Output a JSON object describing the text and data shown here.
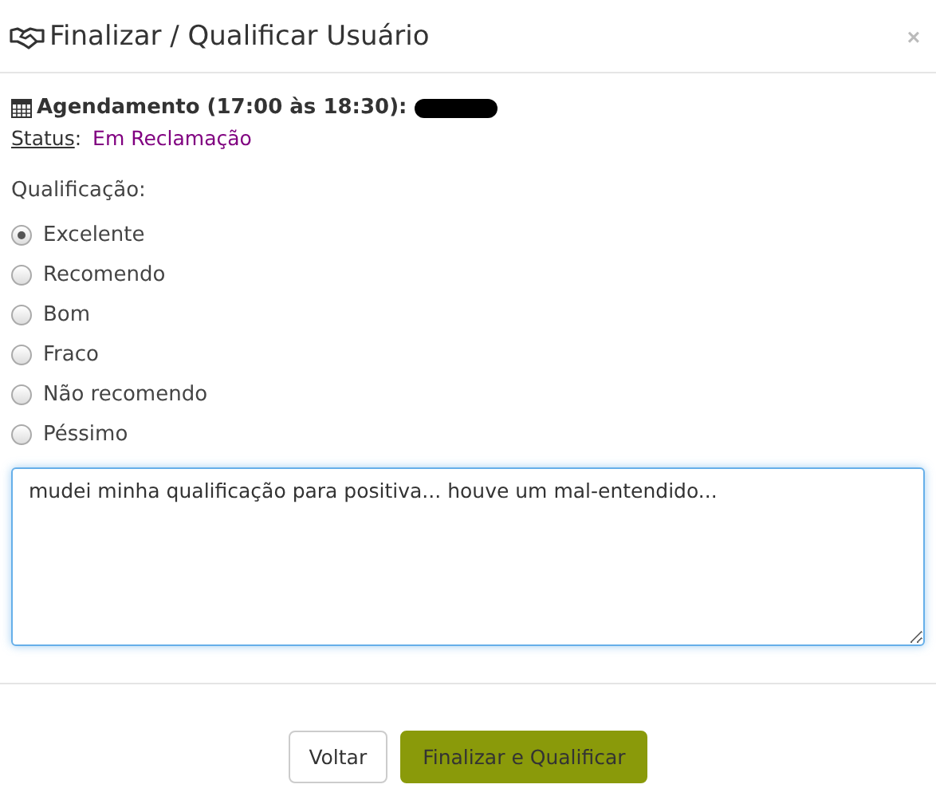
{
  "window": {
    "title": "Finalizar / Qualificar Usuário",
    "close": "×"
  },
  "appointment": {
    "label": "Agendamento (17:00 às 18:30):",
    "redacted": true
  },
  "status": {
    "label": "Status",
    "separator": ":",
    "value": "Em Reclamação"
  },
  "qualification": {
    "label": "Qualificação:",
    "options": [
      {
        "label": "Excelente",
        "selected": true
      },
      {
        "label": "Recomendo",
        "selected": false
      },
      {
        "label": "Bom",
        "selected": false
      },
      {
        "label": "Fraco",
        "selected": false
      },
      {
        "label": "Não recomendo",
        "selected": false
      },
      {
        "label": "Péssimo",
        "selected": false
      }
    ]
  },
  "comment": {
    "value": "mudei minha qualificação para positiva... houve um mal-entendido...",
    "focused": true
  },
  "buttons": [
    {
      "label": "Voltar",
      "kind": "default"
    },
    {
      "label": "Finalizar e Qualificar",
      "kind": "primary"
    }
  ]
}
